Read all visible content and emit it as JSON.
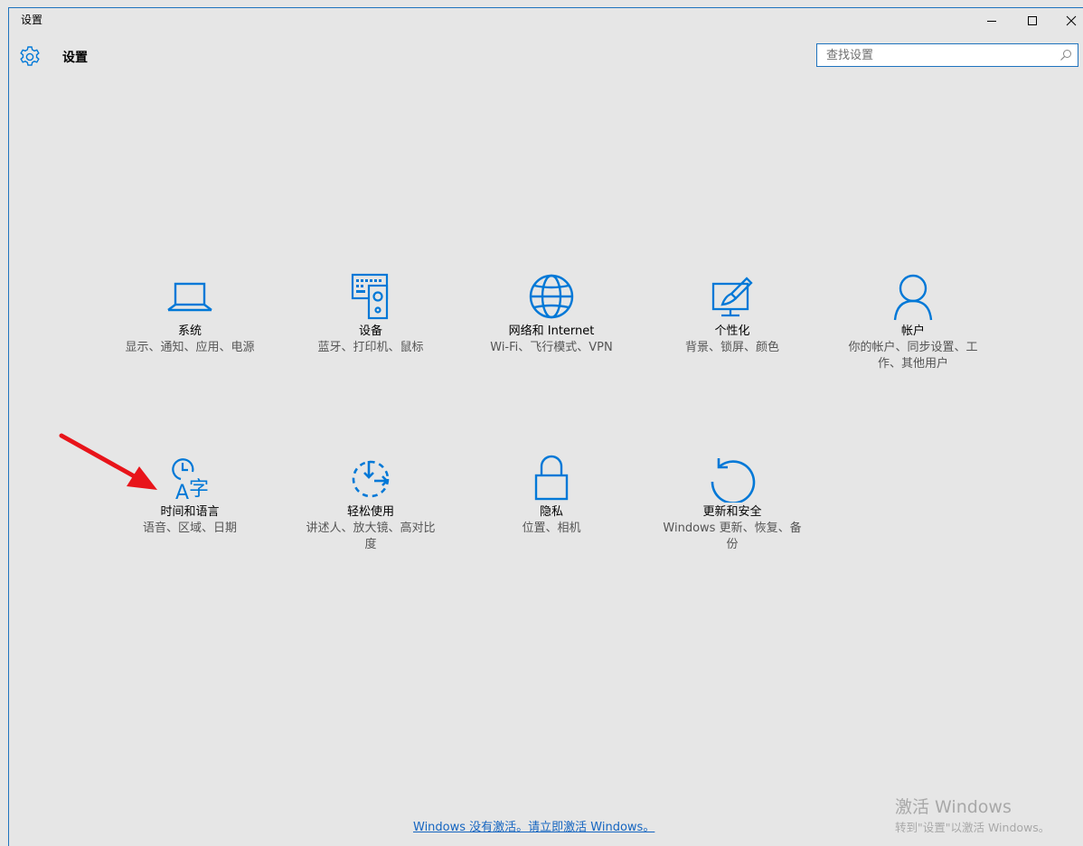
{
  "window": {
    "title": "设置"
  },
  "header": {
    "title": "设置",
    "search_placeholder": "查找设置"
  },
  "tiles": [
    {
      "name": "系统",
      "desc": "显示、通知、应用、电源",
      "icon": "laptop-icon"
    },
    {
      "name": "设备",
      "desc": "蓝牙、打印机、鼠标",
      "icon": "devices-icon"
    },
    {
      "name": "网络和 Internet",
      "desc": "Wi-Fi、飞行模式、VPN",
      "icon": "globe-icon"
    },
    {
      "name": "个性化",
      "desc": "背景、锁屏、颜色",
      "icon": "personalization-icon"
    },
    {
      "name": "帐户",
      "desc": "你的帐户、同步设置、工作、其他用户",
      "icon": "person-icon"
    },
    {
      "name": "时间和语言",
      "desc": "语音、区域、日期",
      "icon": "time-language-icon"
    },
    {
      "name": "轻松使用",
      "desc": "讲述人、放大镜、高对比度",
      "icon": "ease-of-access-icon"
    },
    {
      "name": "隐私",
      "desc": "位置、相机",
      "icon": "lock-icon"
    },
    {
      "name": "更新和安全",
      "desc": "Windows 更新、恢复、备份",
      "icon": "update-icon"
    }
  ],
  "activation": {
    "link": "Windows 没有激活。请立即激活 Windows。",
    "watermark_title": "激活 Windows",
    "watermark_sub": "转到\"设置\"以激活 Windows。"
  },
  "colors": {
    "accent": "#0078d7",
    "background": "#e6e6e6",
    "annotation_arrow": "#e8141a"
  }
}
